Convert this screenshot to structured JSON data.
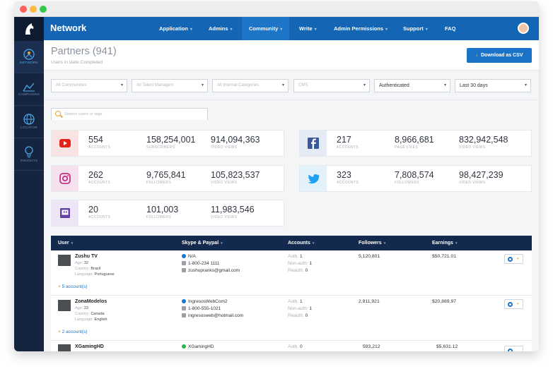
{
  "app": {
    "brand": "Network"
  },
  "nav": [
    {
      "label": "Application",
      "caret": true
    },
    {
      "label": "Admins",
      "caret": true
    },
    {
      "label": "Community",
      "caret": true
    },
    {
      "label": "Write",
      "caret": true
    },
    {
      "label": "Admin Permissions",
      "caret": true
    },
    {
      "label": "Support",
      "caret": true
    },
    {
      "label": "FAQ",
      "caret": false
    }
  ],
  "sidebar": [
    {
      "label": "NETWORK",
      "icon": "network-icon"
    },
    {
      "label": "CAMPAIGNS",
      "icon": "campaigns-icon"
    },
    {
      "label": "LOCATOR",
      "icon": "globe-icon"
    },
    {
      "label": "INSIGHTS",
      "icon": "lightbulb-icon"
    }
  ],
  "page": {
    "title": "Partners (941)",
    "subtitle": "Users in state Completed",
    "download_label": "Download as CSV"
  },
  "filters": [
    {
      "value": "All Communities",
      "placeholder": true
    },
    {
      "value": "All Talent Managers",
      "placeholder": true
    },
    {
      "value": "All Internal Categories",
      "placeholder": true
    },
    {
      "value": "CMS",
      "placeholder": true
    },
    {
      "value": "Authenticated",
      "placeholder": false
    },
    {
      "value": "Last 30 days",
      "placeholder": false
    }
  ],
  "search": {
    "placeholder": "Search users or tags"
  },
  "stats": [
    {
      "platform": "YouTube",
      "icon": "youtube-icon",
      "color": "#e62117",
      "bg": "#f9e3e3",
      "items": [
        {
          "v": "554",
          "k": "ACCOUNTS"
        },
        {
          "v": "158,254,001",
          "k": "SUBSCRIBERS"
        },
        {
          "v": "914,094,363",
          "k": "VIDEO VIEWS"
        }
      ]
    },
    {
      "platform": "Facebook",
      "icon": "facebook-icon",
      "color": "#3b5998",
      "bg": "#e5ebf5",
      "items": [
        {
          "v": "217",
          "k": "ACCOUNTS"
        },
        {
          "v": "8,966,681",
          "k": "PAGE LIKES"
        },
        {
          "v": "832,942,548",
          "k": "VIDEO VIEWS"
        }
      ]
    },
    {
      "platform": "Instagram",
      "icon": "instagram-icon",
      "color": "#c13584",
      "bg": "#f6e2ee",
      "items": [
        {
          "v": "262",
          "k": "ACCOUNTS"
        },
        {
          "v": "9,765,841",
          "k": "FOLLOWERS"
        },
        {
          "v": "105,823,537",
          "k": "VIDEO VIEWS"
        }
      ]
    },
    {
      "platform": "Twitter",
      "icon": "twitter-icon",
      "color": "#1da1f2",
      "bg": "#e3f1fb",
      "items": [
        {
          "v": "323",
          "k": "ACCOUNTS"
        },
        {
          "v": "7,808,574",
          "k": "FOLLOWERS"
        },
        {
          "v": "98,427,239",
          "k": "VIDEO VIEWS"
        }
      ]
    },
    {
      "platform": "Twitch",
      "icon": "twitch-icon",
      "color": "#6441a5",
      "bg": "#ece6f6",
      "items": [
        {
          "v": "20",
          "k": "ACCOUNTS"
        },
        {
          "v": "101,003",
          "k": "FOLLOWERS"
        },
        {
          "v": "11,983,546",
          "k": "VIDEO VIEWS"
        }
      ]
    }
  ],
  "table": {
    "headers": [
      "User",
      "Skype & Paypal",
      "Accounts",
      "Followers",
      "Earnings"
    ],
    "rows": [
      {
        "name": "Zushu TV",
        "age": "32",
        "country": "Brazil",
        "language": "Portuguese",
        "skype": "N/A",
        "phone": "1-800-234 1111",
        "email": "zushupranks@gmail.com",
        "skype_color": "#1a73c9",
        "auth": "1",
        "nonauth": "1",
        "reauth": "0",
        "followers": "5,120,801",
        "earnings": "$50,721.01",
        "more": "5 account(s)"
      },
      {
        "name": "ZonaModelos",
        "age": "23",
        "country": "Canada",
        "language": "English",
        "skype": "IngresosWebCom2",
        "phone": "1-800-555-1021",
        "email": "ingresosweb@hotmail.com",
        "skype_color": "#1a73c9",
        "auth": "1",
        "nonauth": "1",
        "reauth": "0",
        "followers": "2,911,921",
        "earnings": "$20,889.97",
        "more": "2 account(s)"
      },
      {
        "name": "XGamingHD",
        "skype": "XGamingHD",
        "skype_color": "#2fb34a",
        "auth": "0",
        "followers": "593,212",
        "earnings": "$5,631.12"
      }
    ],
    "labels": {
      "age": "Age:",
      "country": "Country:",
      "language": "Language:",
      "auth": "Auth:",
      "nonauth": "Non-auth:",
      "reauth": "Reauth:"
    }
  }
}
